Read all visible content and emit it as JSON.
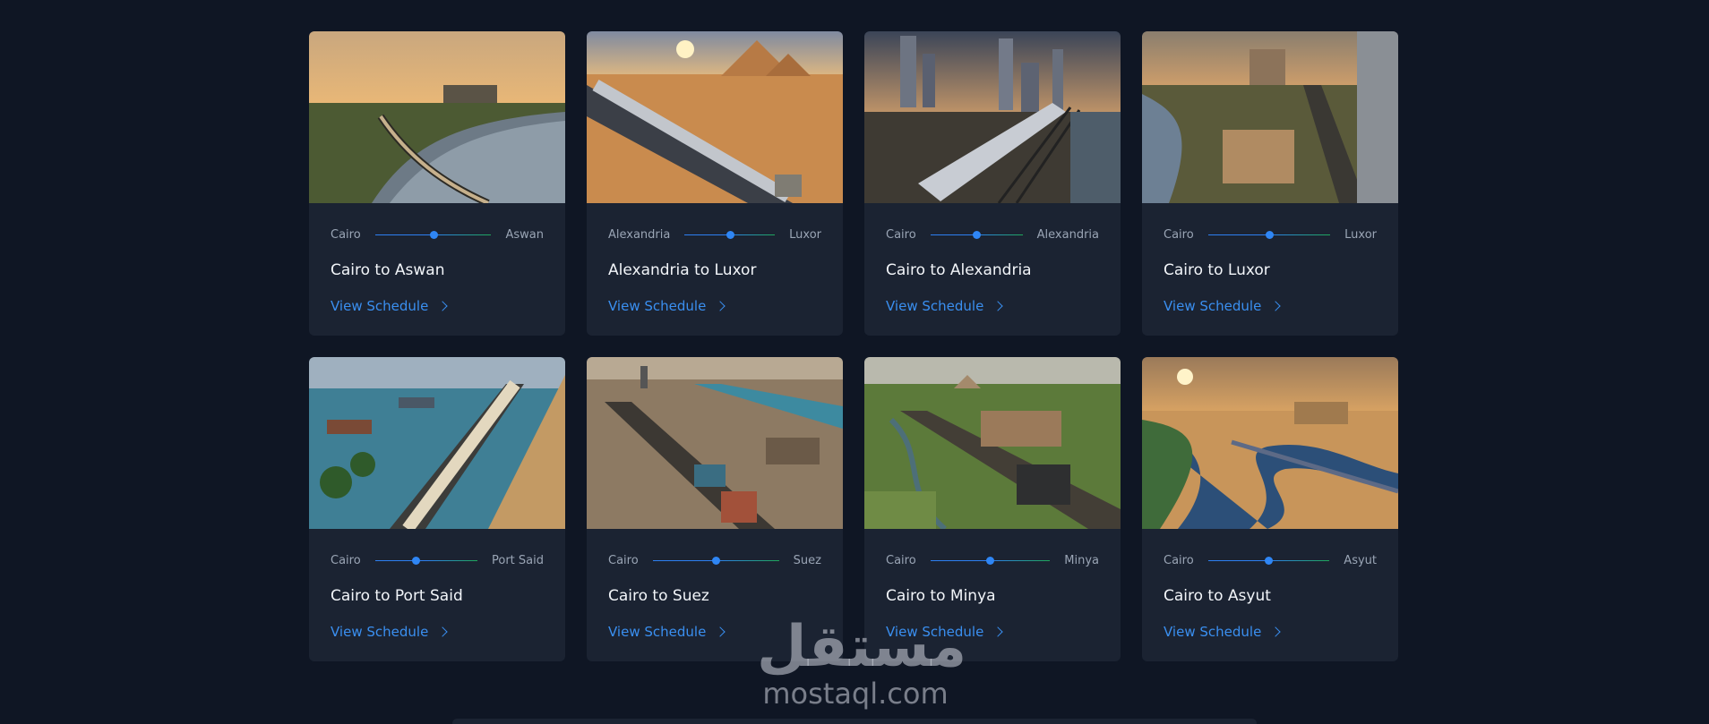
{
  "routes": [
    {
      "from": "Cairo",
      "to": "Aswan",
      "title": "Cairo to Aswan",
      "link": "View Schedule",
      "scene": "nile-river"
    },
    {
      "from": "Alexandria",
      "to": "Luxor",
      "title": "Alexandria to Luxor",
      "link": "View Schedule",
      "scene": "desert-pyramids"
    },
    {
      "from": "Cairo",
      "to": "Alexandria",
      "title": "Cairo to Alexandria",
      "link": "View Schedule",
      "scene": "city-skyline"
    },
    {
      "from": "Cairo",
      "to": "Luxor",
      "title": "Cairo to Luxor",
      "link": "View Schedule",
      "scene": "village-tracks"
    },
    {
      "from": "Cairo",
      "to": "Port Said",
      "title": "Cairo to Port Said",
      "link": "View Schedule",
      "scene": "coast-palms"
    },
    {
      "from": "Cairo",
      "to": "Suez",
      "title": "Cairo to Suez",
      "link": "View Schedule",
      "scene": "freight-port"
    },
    {
      "from": "Cairo",
      "to": "Minya",
      "title": "Cairo to Minya",
      "link": "View Schedule",
      "scene": "green-fields"
    },
    {
      "from": "Cairo",
      "to": "Asyut",
      "title": "Cairo to Asyut",
      "link": "View Schedule",
      "scene": "river-sunset"
    }
  ],
  "watermark": {
    "arabic": "مستقل",
    "latin": "mostaql.com"
  },
  "colors": {
    "background": "#0f1624",
    "card": "#1b2332",
    "accent": "#3a8ff0",
    "track_end": "#1fa85a"
  }
}
